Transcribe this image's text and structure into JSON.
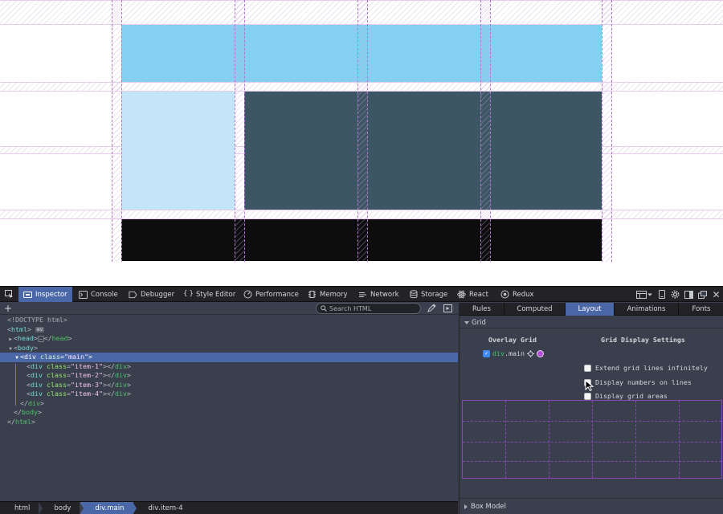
{
  "viewport": {
    "items": [
      {
        "class": "item-1",
        "color": "#85d0f0"
      },
      {
        "class": "item-2",
        "color": "#c4e5f8"
      },
      {
        "class": "item-3",
        "color": "#3c5763"
      },
      {
        "class": "item-4",
        "color": "#0d0d0e"
      }
    ],
    "overlay_color": "#b277d1"
  },
  "toolbar": {
    "tabs": [
      {
        "label": "Inspector",
        "icon": "inspector-icon",
        "active": true
      },
      {
        "label": "Console",
        "icon": "console-icon"
      },
      {
        "label": "Debugger",
        "icon": "debugger-icon"
      },
      {
        "label": "Style Editor",
        "icon": "braces-icon"
      },
      {
        "label": "Performance",
        "icon": "performance-icon"
      },
      {
        "label": "Memory",
        "icon": "memory-icon"
      },
      {
        "label": "Network",
        "icon": "network-icon"
      },
      {
        "label": "Storage",
        "icon": "storage-icon"
      },
      {
        "label": "React",
        "icon": "react-icon"
      },
      {
        "label": "Redux",
        "icon": "redux-icon"
      }
    ],
    "right_icons": [
      "frame-picker-icon",
      "responsive-icon",
      "settings-icon",
      "dock-side-icon",
      "separate-window-icon",
      "close-icon"
    ]
  },
  "markup": {
    "search_placeholder": "Search HTML",
    "add_node": "+",
    "tree": {
      "doctype": "<!DOCTYPE html>",
      "html_open": "html",
      "ev_badge": "ev",
      "head": "head",
      "body": "body",
      "div_tag": "div",
      "class_attr": "class",
      "main_value": "\"main\"",
      "item1_value": "\"item-1\"",
      "item2_value": "\"item-2\"",
      "item3_value": "\"item-3\"",
      "item4_value": "\"item-4\""
    }
  },
  "breadcrumbs": [
    {
      "label": "html"
    },
    {
      "label": "body"
    },
    {
      "label": "div.main",
      "active": true
    },
    {
      "label": "div",
      "suffix": ".item-4"
    }
  ],
  "sidebar": {
    "tabs": [
      "Rules",
      "Computed",
      "Layout",
      "Animations",
      "Fonts"
    ],
    "active_tab": "Layout",
    "grid_section": "Grid",
    "overlay_heading": "Overlay Grid",
    "settings_heading": "Grid Display Settings",
    "grid_item": {
      "tag": "div",
      "class": ".main",
      "checked": true,
      "color": "#b34fd6"
    },
    "settings": [
      {
        "label": "Extend grid lines infinitely",
        "checked": false
      },
      {
        "label": "Display numbers on lines",
        "checked": false
      },
      {
        "label": "Display grid areas",
        "checked": false
      }
    ],
    "box_model": "Box Model"
  }
}
